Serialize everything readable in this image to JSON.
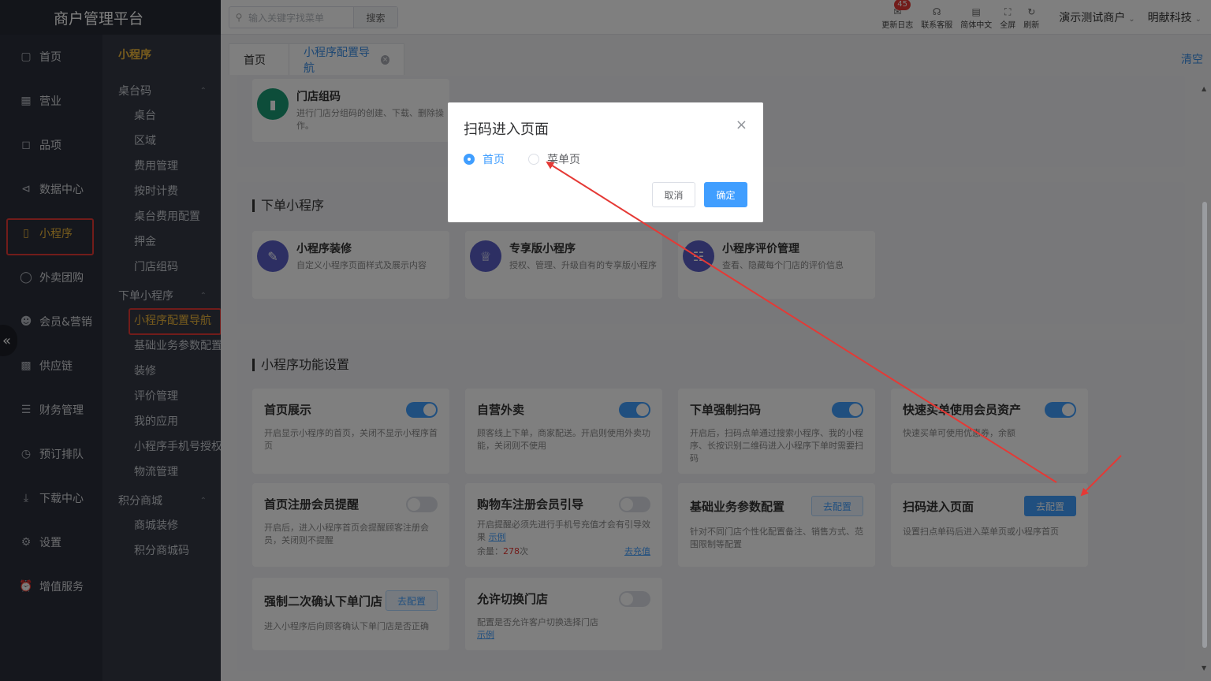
{
  "brand": "商户管理平台",
  "sidebar": {
    "items": [
      {
        "label": "首页",
        "icon": "document-icon"
      },
      {
        "label": "营业",
        "icon": "calendar-icon"
      },
      {
        "label": "品项",
        "icon": "bag-icon"
      },
      {
        "label": "数据中心",
        "icon": "share-icon"
      },
      {
        "label": "小程序",
        "icon": "phone-icon"
      },
      {
        "label": "外卖团购",
        "icon": "bike-icon"
      },
      {
        "label": "会员&营销",
        "icon": "user-icon"
      },
      {
        "label": "供应链",
        "icon": "truck-icon"
      },
      {
        "label": "财务管理",
        "icon": "database-icon"
      },
      {
        "label": "预订排队",
        "icon": "clock-icon"
      },
      {
        "label": "下载中心",
        "icon": "download-icon"
      },
      {
        "label": "设置",
        "icon": "gear-icon"
      },
      {
        "label": "增值服务",
        "icon": "alarm-icon"
      }
    ]
  },
  "subnav": {
    "header": "小程序",
    "groups": [
      {
        "label": "桌台码",
        "items": [
          "桌台",
          "区域",
          "费用管理",
          "按时计费",
          "桌台费用配置",
          "押金",
          "门店组码"
        ]
      },
      {
        "label": "下单小程序",
        "items": [
          "小程序配置导航",
          "基础业务参数配置",
          "装修",
          "评价管理",
          "我的应用",
          "小程序手机号授权",
          "物流管理"
        ]
      },
      {
        "label": "积分商城",
        "items": [
          "商城装修",
          "积分商城码"
        ]
      }
    ]
  },
  "topbar": {
    "search_placeholder": "输入关键字找菜单",
    "search_button": "搜索",
    "tools": [
      {
        "label": "更新日志",
        "icon": "message-icon",
        "badge": "45"
      },
      {
        "label": "联系客服",
        "icon": "headset-icon"
      },
      {
        "label": "简体中文",
        "icon": "translate-icon"
      },
      {
        "label": "全屏",
        "icon": "fullscreen-icon"
      },
      {
        "label": "刷新",
        "icon": "refresh-icon"
      }
    ],
    "merchant": "演示测试商户",
    "company": "明献科技"
  },
  "tabs": {
    "home": "首页",
    "current": "小程序配置导航",
    "clear": "清空"
  },
  "store_code": {
    "title": "门店组码",
    "desc": "进行门店分组码的创建、下载、删除操作。"
  },
  "order_section": {
    "title": "下单小程序",
    "cards": [
      {
        "title": "小程序装修",
        "desc": "自定义小程序页面样式及展示内容",
        "color": "#5a5fc7"
      },
      {
        "title": "专享版小程序",
        "desc": "授权、管理、升级自有的专享版小程序",
        "color": "#5a5fc7"
      },
      {
        "title": "小程序评价管理",
        "desc": "查看、隐藏每个门店的评价信息",
        "color": "#5a5fc7"
      }
    ]
  },
  "func_section": {
    "title": "小程序功能设置",
    "cards": [
      {
        "title": "首页展示",
        "desc": "开启显示小程序的首页，关闭不显示小程序首页",
        "state": "on"
      },
      {
        "title": "自营外卖",
        "desc": "顾客线上下单，商家配送。开启则使用外卖功能，关闭则不使用",
        "state": "on"
      },
      {
        "title": "下单强制扫码",
        "desc": "开启后，扫码点单通过搜索小程序、我的小程序、长按识别二维码进入小程序下单时需要扫码",
        "state": "on"
      },
      {
        "title": "快速买单使用会员资产",
        "desc": "快速买单可使用优惠券，余额",
        "state": "on"
      },
      {
        "title": "首页注册会员提醒",
        "desc": "开启后，进入小程序首页会提醒顾客注册会员，关闭则不提醒",
        "state": "off"
      },
      {
        "title": "购物车注册会员引导",
        "desc": "开启提醒必须先进行手机号充值才会有引导效果",
        "link": "示例",
        "balance_label": "余量：",
        "balance_value": "278",
        "balance_unit": "次",
        "recharge": "去充值",
        "state": "off"
      },
      {
        "title": "基础业务参数配置",
        "desc": "针对不同门店个性化配置备注、销售方式、范围限制等配置",
        "button": "去配置"
      },
      {
        "title": "扫码进入页面",
        "desc": "设置扫点单码后进入菜单页或小程序首页",
        "button": "去配置"
      },
      {
        "title": "强制二次确认下单门店",
        "desc": "进入小程序后向顾客确认下单门店是否正确",
        "button": "去配置"
      },
      {
        "title": "允许切换门店",
        "desc": "配置是否允许客户切换选择门店",
        "link": "示例",
        "state": "off"
      }
    ]
  },
  "dialog": {
    "title": "扫码进入页面",
    "options": [
      "首页",
      "菜单页"
    ],
    "selected": "首页",
    "cancel": "取消",
    "confirm": "确定"
  },
  "colors": {
    "accent": "#409eff",
    "highlight": "#f0b93a",
    "annotation": "#e53935"
  }
}
